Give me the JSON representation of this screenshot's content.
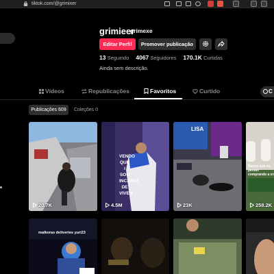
{
  "browser": {
    "url": "tiktok.com/@grimixer"
  },
  "profile": {
    "username": "grimieer",
    "nickname": "grimexe",
    "edit_button": "Editar Perfil",
    "promote_button": "Promover publicação",
    "following_count": "13",
    "following_label": "Seguindo",
    "followers_count": "4067",
    "followers_label": "Seguidores",
    "likes_count": "170.1K",
    "likes_label": "Curtidas",
    "bio": "Ainda sem descrição."
  },
  "tabs": [
    {
      "label": "Vídeos",
      "icon": "grid-icon",
      "active": false
    },
    {
      "label": "Republicações",
      "icon": "repost-icon",
      "active": false
    },
    {
      "label": "Favoritos",
      "icon": "bookmark-icon",
      "active": true
    },
    {
      "label": "Curtido",
      "icon": "heart-icon",
      "active": false
    }
  ],
  "tab_extra": "C",
  "subtabs": {
    "posts": "Publicações 609",
    "collections": "Coleções 0"
  },
  "videos": [
    {
      "views": "20.7K",
      "overlay": ""
    },
    {
      "views": "4.5M",
      "overlay": "VENDO QUE I SOU INCAPAZ DE VIVER"
    },
    {
      "views": "23K",
      "overlay": "LISA"
    },
    {
      "views": "258.2K",
      "overlay": "Banco que eu pensei comprando a era"
    },
    {
      "views": "",
      "overlay": "malkoras deliveries yuri23"
    },
    {
      "views": "",
      "overlay": ""
    },
    {
      "views": "",
      "overlay": ""
    },
    {
      "views": "",
      "overlay": ""
    }
  ],
  "colors": {
    "accent": "#fe2c55",
    "background": "#000000",
    "button_secondary": "#2f2f2f"
  }
}
